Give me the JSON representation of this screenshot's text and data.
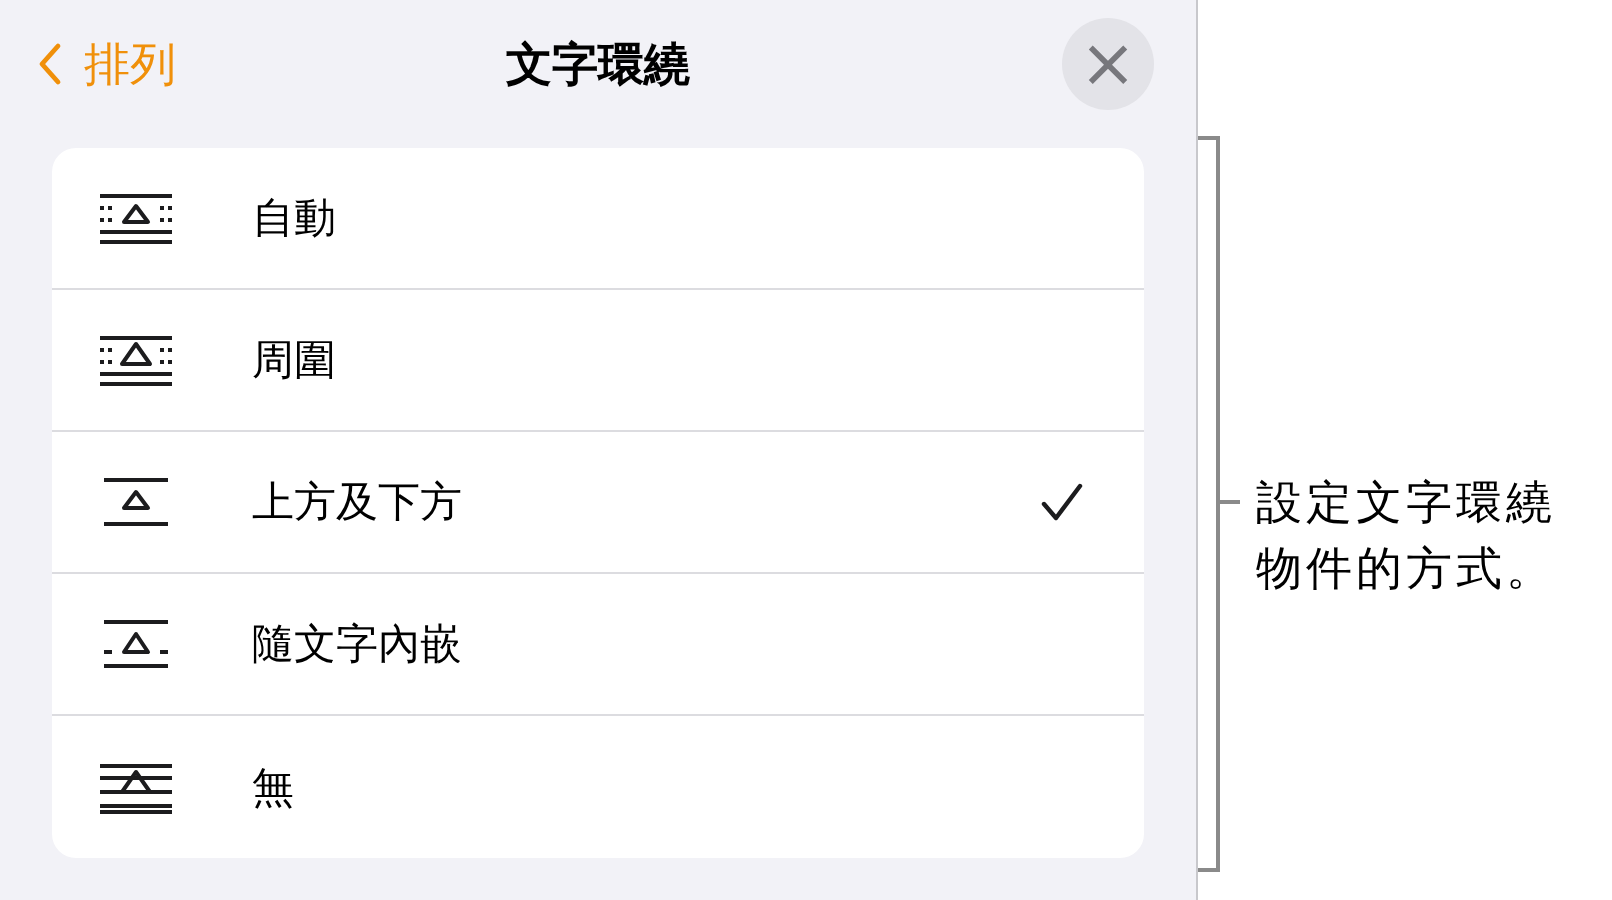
{
  "header": {
    "back": "排列",
    "title": "文字環繞",
    "close": "×"
  },
  "options": [
    {
      "kind": "auto",
      "label": "自動",
      "selected": false
    },
    {
      "kind": "around",
      "label": "周圍",
      "selected": false
    },
    {
      "kind": "above_below",
      "label": "上方及下方",
      "selected": true
    },
    {
      "kind": "inline",
      "label": "隨文字內嵌",
      "selected": false
    },
    {
      "kind": "none",
      "label": "無",
      "selected": false
    }
  ],
  "callout": "設定文字環繞物件的方式。"
}
